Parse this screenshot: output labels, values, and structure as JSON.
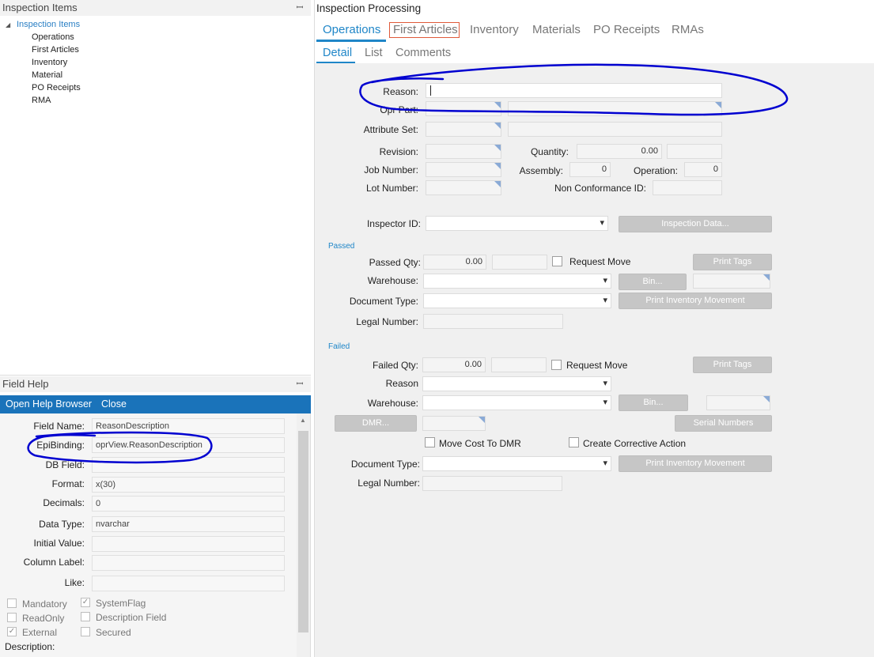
{
  "left_panel": {
    "title": "Inspection Items",
    "pin": "ꟷ",
    "tree": {
      "root": "Inspection Items",
      "items": [
        "Operations",
        "First Articles",
        "Inventory",
        "Material",
        "PO Receipts",
        "RMA"
      ]
    }
  },
  "field_help": {
    "title": "Field Help",
    "open_help_browser": "Open Help Browser",
    "close": "Close",
    "field_name_label": "Field Name:",
    "field_name_value": "ReasonDescription",
    "epibinding_label": "EpiBinding:",
    "epibinding_value": "oprView.ReasonDescription",
    "db_field_label": "DB Field:",
    "db_field_value": "",
    "format_label": "Format:",
    "format_value": "x(30)",
    "decimals_label": "Decimals:",
    "decimals_value": "0",
    "data_type_label": "Data Type:",
    "data_type_value": "nvarchar",
    "initial_value_label": "Initial Value:",
    "initial_value_value": "",
    "column_label_label": "Column Label:",
    "column_label_value": "",
    "like_label": "Like:",
    "like_value": "",
    "mandatory": "Mandatory",
    "system_flag": "SystemFlag",
    "read_only": "ReadOnly",
    "description_field": "Description Field",
    "external": "External",
    "secured": "Secured",
    "description_label": "Description:"
  },
  "main": {
    "title": "Inspection Processing",
    "tabs": [
      "Operations",
      "First Articles",
      "Inventory",
      "Materials",
      "PO Receipts",
      "RMAs"
    ],
    "subtabs": [
      "Detail",
      "List",
      "Comments"
    ],
    "reason_label": "Reason:",
    "opr_part_label": "Opr Part:",
    "attribute_set_label": "Attribute Set:",
    "revision_label": "Revision:",
    "quantity_label": "Quantity:",
    "quantity_value": "0.00",
    "job_number_label": "Job Number:",
    "assembly_label": "Assembly:",
    "assembly_value": "0",
    "operation_label": "Operation:",
    "operation_value": "0",
    "lot_number_label": "Lot Number:",
    "ncid_label": "Non Conformance ID:",
    "inspector_label": "Inspector ID:",
    "inspection_data_btn": "Inspection Data...",
    "passed": {
      "group": "Passed",
      "qty_label": "Passed Qty:",
      "qty_value": "0.00",
      "request_move": "Request Move",
      "print_tags": "Print Tags",
      "warehouse_label": "Warehouse:",
      "bin_btn": "Bin...",
      "doc_type_label": "Document Type:",
      "print_inv_btn": "Print Inventory Movement",
      "legal_label": "Legal Number:"
    },
    "failed": {
      "group": "Failed",
      "qty_label": "Failed Qty:",
      "qty_value": "0.00",
      "request_move": "Request Move",
      "print_tags": "Print Tags",
      "reason_label": "Reason",
      "warehouse_label": "Warehouse:",
      "bin_btn": "Bin...",
      "dmr_btn": "DMR...",
      "serial_btn": "Serial Numbers",
      "move_cost": "Move Cost To DMR",
      "corrective": "Create Corrective Action",
      "doc_type_label": "Document Type:",
      "print_inv_btn": "Print Inventory Movement",
      "legal_label": "Legal Number:"
    }
  },
  "colors": {
    "accent": "#1f86c8",
    "help_bar": "#1a73ba",
    "annotation": "#0000d0",
    "highlight_box": "#e05a3a"
  }
}
